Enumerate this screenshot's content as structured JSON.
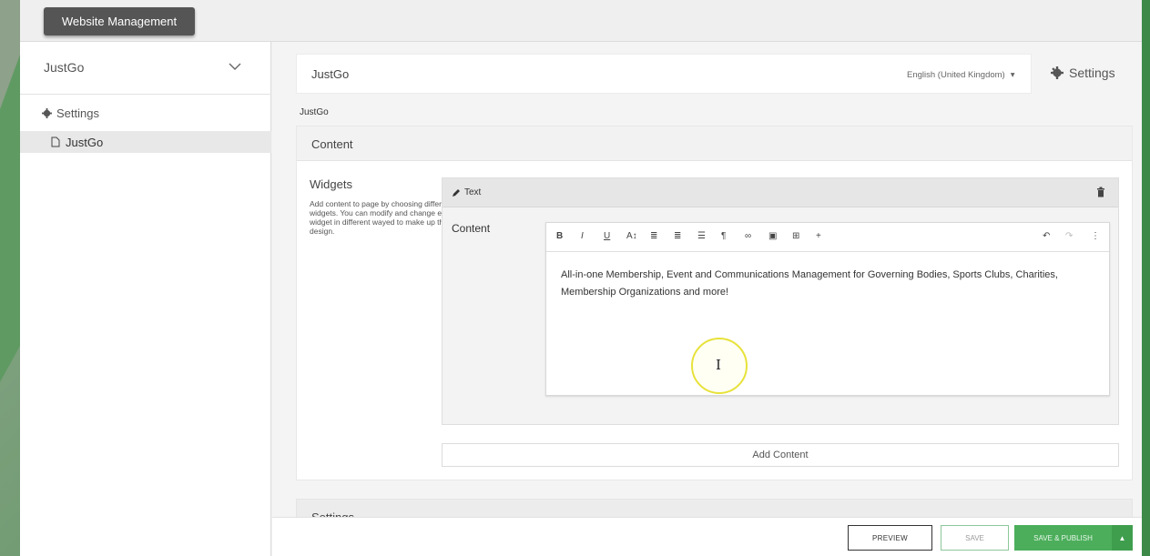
{
  "app": {
    "title_button": "Website Management"
  },
  "sidebar": {
    "site_name": "JustGo",
    "tree_settings": "Settings",
    "tree_page": "JustGo"
  },
  "page_header": {
    "title": "JustGo",
    "language": "English (United Kingdom)",
    "settings_label": "Settings"
  },
  "breadcrumb": "JustGo",
  "content_panel": {
    "title": "Content",
    "widgets_title": "Widgets",
    "widgets_desc": "Add content to page by choosing different widgets. You can modify and change each widget in different wayed to make up the design."
  },
  "widget": {
    "type_label": "Text",
    "content_label": "Content",
    "editor_text": "All-in-one Membership, Event and Communications Management for Governing Bodies, Sports Clubs, Charities, Membership Organizations and more!",
    "toolbar": {
      "bold": "B",
      "italic": "I",
      "underline": "U",
      "text_size": "A↕",
      "align": "≣",
      "align_center": "≣",
      "list": "☰",
      "paragraph": "¶",
      "link": "∞",
      "image": "▣",
      "table": "⊞",
      "insert": "+",
      "undo": "↶",
      "redo": "↷",
      "more": "⋮"
    }
  },
  "add_content_label": "Add Content",
  "settings_panel_title": "Settings",
  "footer": {
    "preview": "PREVIEW",
    "save": "SAVE",
    "save_publish": "SAVE & PUBLISH",
    "caret": "▲"
  },
  "colors": {
    "primary_green": "#4cae5b",
    "dark_button": "#555555",
    "cursor_highlight": "#e7e23a"
  }
}
